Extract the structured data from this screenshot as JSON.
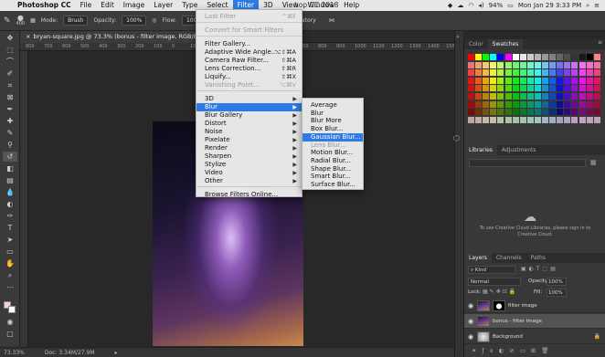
{
  "menubar": {
    "app_name": "Photoshop CC",
    "items": [
      "File",
      "Edit",
      "Image",
      "Layer",
      "Type",
      "Select",
      "Filter",
      "3D",
      "View",
      "Window",
      "Help"
    ],
    "active": "Filter",
    "clock": "Mon Jan 29  3:33 PM",
    "battery": "94%"
  },
  "window_title": "hop CC 2018",
  "options_bar": {
    "brush_size": "400",
    "mode_label": "Mode:",
    "mode_value": "Brush",
    "opacity_label": "Opacity:",
    "opacity_value": "100%",
    "flow_label": "Flow:",
    "flow_value": "100%",
    "atory": "atory"
  },
  "document_tab": "bryan-square.jpg @ 73.3% (bonus - filter image, RGB/8#) *",
  "ruler_ticks": [
    "800",
    "700",
    "600",
    "500",
    "400",
    "300",
    "200",
    "100",
    "0",
    "100",
    "200",
    "300",
    "400",
    "500",
    "600",
    "700",
    "800",
    "900",
    "1000",
    "1100",
    "1200",
    "1300",
    "1400",
    "1500"
  ],
  "filter_menu": {
    "items": [
      {
        "label": "Last Filter",
        "shortcut": "^⌘F",
        "disabled": true
      },
      {
        "label": "Convert for Smart Filters",
        "disabled": true
      },
      {
        "label": "Filter Gallery..."
      },
      {
        "label": "Adaptive Wide Angle...",
        "shortcut": "⌥⇧⌘A"
      },
      {
        "label": "Camera Raw Filter...",
        "shortcut": "⇧⌘A"
      },
      {
        "label": "Lens Correction...",
        "shortcut": "⇧⌘R"
      },
      {
        "label": "Liquify...",
        "shortcut": "⇧⌘X"
      },
      {
        "label": "Vanishing Point...",
        "shortcut": "⌥⌘V",
        "disabled": true
      },
      {
        "label": "3D"
      },
      {
        "label": "Blur",
        "highlighted": true
      },
      {
        "label": "Blur Gallery"
      },
      {
        "label": "Distort"
      },
      {
        "label": "Noise"
      },
      {
        "label": "Pixelate"
      },
      {
        "label": "Render"
      },
      {
        "label": "Sharpen"
      },
      {
        "label": "Stylize"
      },
      {
        "label": "Video"
      },
      {
        "label": "Other"
      },
      {
        "label": "Browse Filters Online..."
      }
    ]
  },
  "blur_submenu": {
    "items": [
      {
        "label": "Average"
      },
      {
        "label": "Blur"
      },
      {
        "label": "Blur More"
      },
      {
        "label": "Box Blur..."
      },
      {
        "label": "Gaussian Blur...",
        "highlighted": true
      },
      {
        "label": "Lens Blur...",
        "disabled": true
      },
      {
        "label": "Motion Blur..."
      },
      {
        "label": "Radial Blur..."
      },
      {
        "label": "Shape Blur..."
      },
      {
        "label": "Smart Blur..."
      },
      {
        "label": "Surface Blur..."
      }
    ]
  },
  "panels": {
    "color_tabs": [
      "Color",
      "Swatches"
    ],
    "library_tabs": [
      "Libraries",
      "Adjustments"
    ],
    "library_message": "To use Creative Cloud Libraries, please sign in to Creative Cloud.",
    "layer_tabs": [
      "Layers",
      "Channels",
      "Paths"
    ],
    "kind_label": "Kind",
    "blend_mode": "Normal",
    "opacity_label": "Opacity:",
    "opacity_value": "100%",
    "lock_label": "Lock:",
    "fill_label": "Fill:",
    "fill_value": "100%",
    "layers": [
      {
        "name": "filter image"
      },
      {
        "name": "bonus - filter image",
        "selected": true
      },
      {
        "name": "Background"
      }
    ]
  },
  "statusbar": {
    "zoom": "73.33%",
    "doc": "Doc: 3.34M/27.9M"
  }
}
